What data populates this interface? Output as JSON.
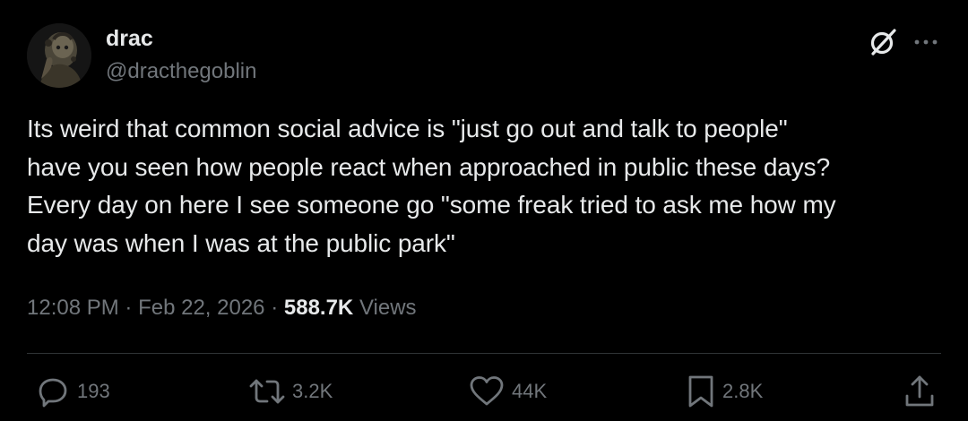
{
  "author": {
    "display_name": "drac",
    "handle": "@dracthegoblin"
  },
  "tweet": {
    "text": "Its weird that common social advice is \"just go out and talk to people\"\nhave you seen how people react when approached in public these days?\nEvery day on here I see someone go \"some freak tried to ask me how my\nday was when I was at the public park\"",
    "time": "12:08 PM",
    "date": "Feb 22, 2026",
    "separator": "·",
    "views_count": "588.7K",
    "views_label": "Views"
  },
  "actions": {
    "replies": "193",
    "reposts": "3.2K",
    "likes": "44K",
    "bookmarks": "2.8K"
  },
  "icons": {
    "grok": "grok-icon",
    "more": "more-icon",
    "reply": "reply-icon",
    "repost": "repost-icon",
    "like": "heart-icon",
    "bookmark": "bookmark-icon",
    "share": "share-icon"
  },
  "colors": {
    "background": "#000000",
    "primary_text": "#e7e9ea",
    "secondary_text": "#71767b",
    "divider": "#2f3336"
  }
}
